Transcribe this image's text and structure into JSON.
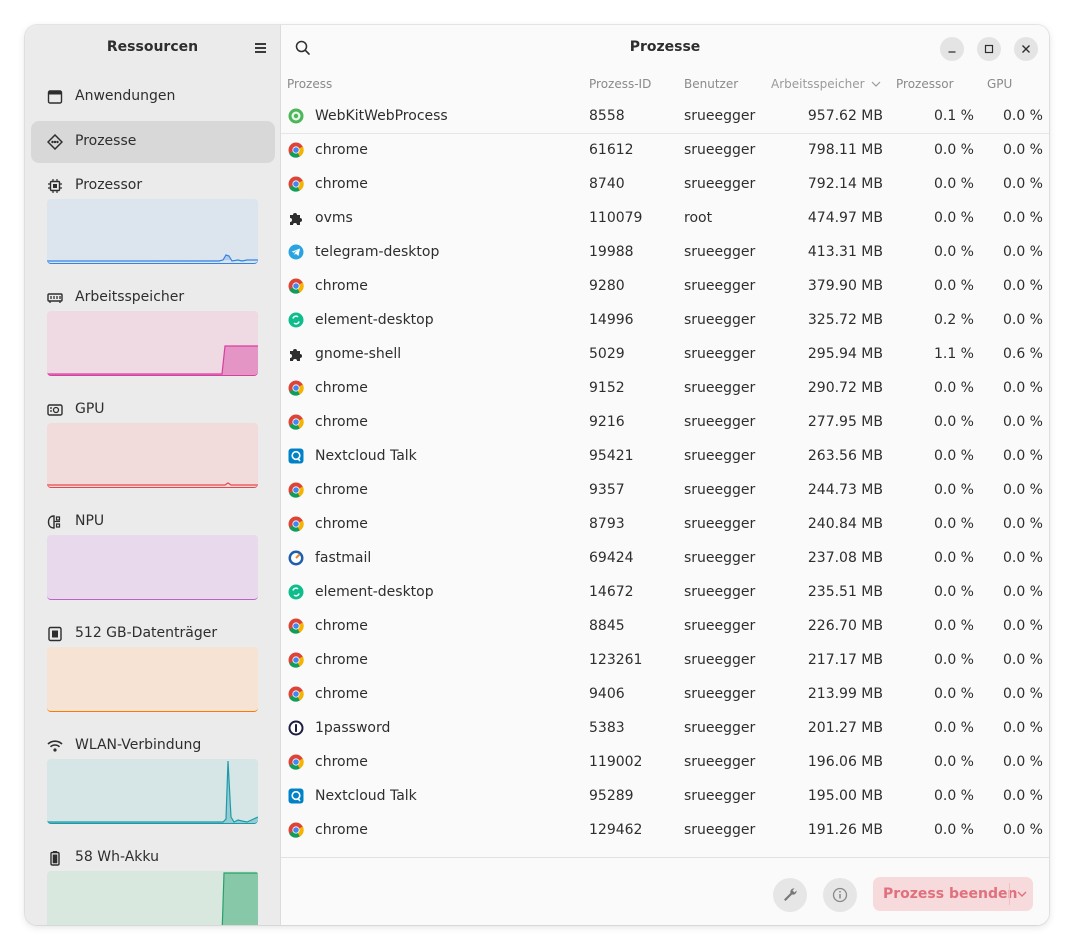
{
  "sidebar": {
    "title": "Ressourcen",
    "nav": [
      {
        "label": "Anwendungen"
      },
      {
        "label": "Prozesse"
      }
    ],
    "resources": [
      {
        "label": "Prozessor",
        "color": "#3584e4",
        "bg": "#dce4ee"
      },
      {
        "label": "Arbeitsspeicher",
        "color": "#d6409f",
        "bg": "#efd9e3"
      },
      {
        "label": "GPU",
        "color": "#e5484d",
        "bg": "#f2dcdb"
      },
      {
        "label": "NPU",
        "color": "#c061cb",
        "bg": "#e9d9ec"
      },
      {
        "label": "512 GB-Datenträger",
        "color": "#ff7800",
        "bg": "#f6e3d3"
      },
      {
        "label": "WLAN-Verbindung",
        "color": "#1c9aa8",
        "bg": "#d6e5e6"
      },
      {
        "label": "58 Wh-Akku",
        "color": "#26a269",
        "bg": "#d8e8df"
      }
    ]
  },
  "header": {
    "title": "Prozesse"
  },
  "columns": {
    "name": "Prozess",
    "pid": "Prozess-ID",
    "user": "Benutzer",
    "memory": "Arbeitsspeicher",
    "cpu": "Prozessor",
    "gpu": "GPU"
  },
  "processes": [
    {
      "icon": "webkit-icon",
      "name": "WebKitWebProcess",
      "pid": "8558",
      "user": "srueegger",
      "memory": "957.62 MB",
      "cpu": "0.1 %",
      "gpu": "0.0 %"
    },
    {
      "icon": "chrome-icon",
      "name": "chrome",
      "pid": "61612",
      "user": "srueegger",
      "memory": "798.11 MB",
      "cpu": "0.0 %",
      "gpu": "0.0 %"
    },
    {
      "icon": "chrome-icon",
      "name": "chrome",
      "pid": "8740",
      "user": "srueegger",
      "memory": "792.14 MB",
      "cpu": "0.0 %",
      "gpu": "0.0 %"
    },
    {
      "icon": "puzzle-icon",
      "name": "ovms",
      "pid": "110079",
      "user": "root",
      "memory": "474.97 MB",
      "cpu": "0.0 %",
      "gpu": "0.0 %"
    },
    {
      "icon": "telegram-icon",
      "name": "telegram-desktop",
      "pid": "19988",
      "user": "srueegger",
      "memory": "413.31 MB",
      "cpu": "0.0 %",
      "gpu": "0.0 %"
    },
    {
      "icon": "chrome-icon",
      "name": "chrome",
      "pid": "9280",
      "user": "srueegger",
      "memory": "379.90 MB",
      "cpu": "0.0 %",
      "gpu": "0.0 %"
    },
    {
      "icon": "element-icon",
      "name": "element-desktop",
      "pid": "14996",
      "user": "srueegger",
      "memory": "325.72 MB",
      "cpu": "0.2 %",
      "gpu": "0.0 %"
    },
    {
      "icon": "puzzle-icon",
      "name": "gnome-shell",
      "pid": "5029",
      "user": "srueegger",
      "memory": "295.94 MB",
      "cpu": "1.1 %",
      "gpu": "0.6 %"
    },
    {
      "icon": "chrome-icon",
      "name": "chrome",
      "pid": "9152",
      "user": "srueegger",
      "memory": "290.72 MB",
      "cpu": "0.0 %",
      "gpu": "0.0 %"
    },
    {
      "icon": "chrome-icon",
      "name": "chrome",
      "pid": "9216",
      "user": "srueegger",
      "memory": "277.95 MB",
      "cpu": "0.0 %",
      "gpu": "0.0 %"
    },
    {
      "icon": "nextcloud-talk-icon",
      "name": "Nextcloud Talk",
      "pid": "95421",
      "user": "srueegger",
      "memory": "263.56 MB",
      "cpu": "0.0 %",
      "gpu": "0.0 %"
    },
    {
      "icon": "chrome-icon",
      "name": "chrome",
      "pid": "9357",
      "user": "srueegger",
      "memory": "244.73 MB",
      "cpu": "0.0 %",
      "gpu": "0.0 %"
    },
    {
      "icon": "chrome-icon",
      "name": "chrome",
      "pid": "8793",
      "user": "srueegger",
      "memory": "240.84 MB",
      "cpu": "0.0 %",
      "gpu": "0.0 %"
    },
    {
      "icon": "fastmail-icon",
      "name": "fastmail",
      "pid": "69424",
      "user": "srueegger",
      "memory": "237.08 MB",
      "cpu": "0.0 %",
      "gpu": "0.0 %"
    },
    {
      "icon": "element-icon",
      "name": "element-desktop",
      "pid": "14672",
      "user": "srueegger",
      "memory": "235.51 MB",
      "cpu": "0.0 %",
      "gpu": "0.0 %"
    },
    {
      "icon": "chrome-icon",
      "name": "chrome",
      "pid": "8845",
      "user": "srueegger",
      "memory": "226.70 MB",
      "cpu": "0.0 %",
      "gpu": "0.0 %"
    },
    {
      "icon": "chrome-icon",
      "name": "chrome",
      "pid": "123261",
      "user": "srueegger",
      "memory": "217.17 MB",
      "cpu": "0.0 %",
      "gpu": "0.0 %"
    },
    {
      "icon": "chrome-icon",
      "name": "chrome",
      "pid": "9406",
      "user": "srueegger",
      "memory": "213.99 MB",
      "cpu": "0.0 %",
      "gpu": "0.0 %"
    },
    {
      "icon": "onepassword-icon",
      "name": "1password",
      "pid": "5383",
      "user": "srueegger",
      "memory": "201.27 MB",
      "cpu": "0.0 %",
      "gpu": "0.0 %"
    },
    {
      "icon": "chrome-icon",
      "name": "chrome",
      "pid": "119002",
      "user": "srueegger",
      "memory": "196.06 MB",
      "cpu": "0.0 %",
      "gpu": "0.0 %"
    },
    {
      "icon": "nextcloud-talk-icon",
      "name": "Nextcloud Talk",
      "pid": "95289",
      "user": "srueegger",
      "memory": "195.00 MB",
      "cpu": "0.0 %",
      "gpu": "0.0 %"
    },
    {
      "icon": "chrome-icon",
      "name": "chrome",
      "pid": "129462",
      "user": "srueegger",
      "memory": "191.26 MB",
      "cpu": "0.0 %",
      "gpu": "0.0 %"
    }
  ],
  "footer": {
    "kill_label": "Prozess beenden"
  }
}
